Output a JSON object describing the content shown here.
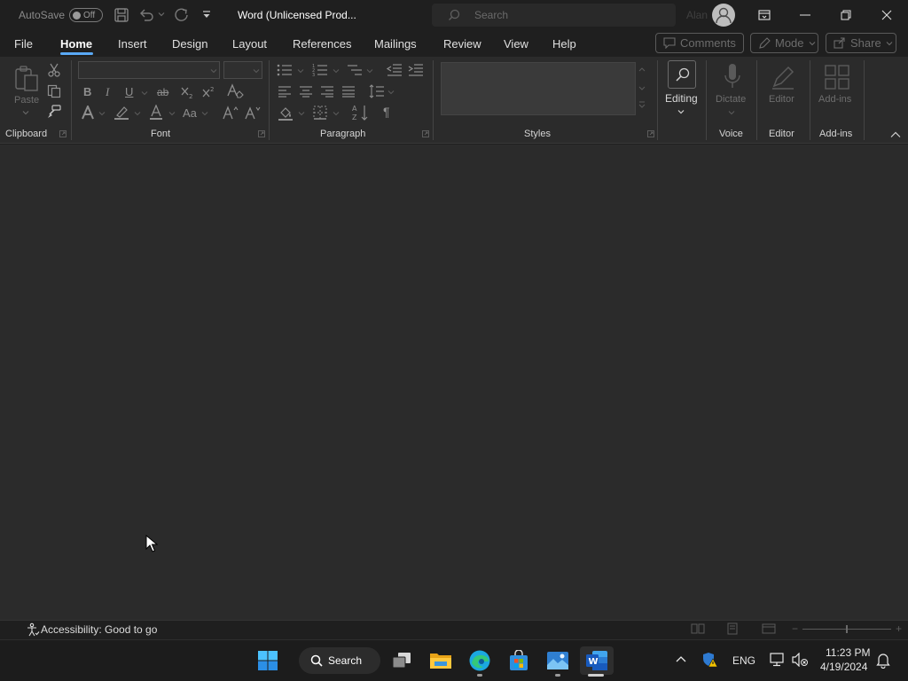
{
  "titlebar": {
    "autosave_label": "AutoSave",
    "autosave_state": "Off",
    "title": "Word (Unlicensed Prod...",
    "search_placeholder": "Search",
    "user_name": "Alan"
  },
  "menu": {
    "tabs": [
      "File",
      "Home",
      "Insert",
      "Design",
      "Layout",
      "References",
      "Mailings",
      "Review",
      "View",
      "Help"
    ],
    "active": "Home",
    "comments": "Comments",
    "mode": "Mode",
    "share": "Share"
  },
  "ribbon": {
    "clipboard": {
      "label": "Clipboard",
      "paste": "Paste"
    },
    "font": {
      "label": "Font"
    },
    "paragraph": {
      "label": "Paragraph"
    },
    "styles": {
      "label": "Styles"
    },
    "editing": {
      "label": "Editing"
    },
    "voice": {
      "label": "Voice",
      "dictate": "Dictate"
    },
    "editor": {
      "label": "Editor",
      "button": "Editor"
    },
    "addins": {
      "label": "Add-ins",
      "button": "Add-ins"
    },
    "font_buttons": {
      "bold": "B",
      "italic": "I",
      "underline": "U",
      "strike": "ab",
      "change_case": "Aa",
      "show_marks": "¶"
    }
  },
  "statusbar": {
    "accessibility": "Accessibility: Good to go"
  },
  "taskbar": {
    "search_label": "Search",
    "lang": "ENG",
    "time": "11:23 PM",
    "date": "4/19/2024"
  },
  "colors": {
    "accent": "#5aa9f5",
    "word_blue": "#185abd",
    "window_bg": "#1f1f1f",
    "ribbon_bg": "#2b2b2b"
  }
}
